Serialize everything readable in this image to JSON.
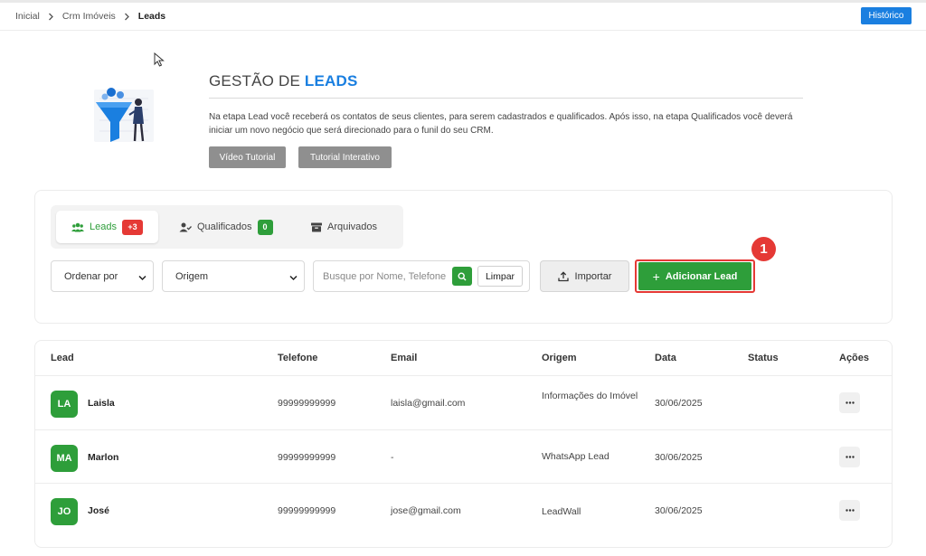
{
  "breadcrumb": [
    "Inicial",
    "Crm Imóveis",
    "Leads"
  ],
  "header": {
    "historico_label": "Histórico"
  },
  "hero": {
    "title_prefix": "GESTÃO DE ",
    "title_accent": "LEADS",
    "description": "Na etapa Lead você receberá os contatos de seus clientes, para serem cadastrados e qualificados. Após isso, na etapa Qualificados você deverá iniciar um novo negócio que será direcionado para o funil do seu CRM.",
    "video_label": "Vídeo Tutorial",
    "interativo_label": "Tutorial Interativo"
  },
  "tabs": [
    {
      "label": "Leads",
      "badge": "+3",
      "icon": "users-icon"
    },
    {
      "label": "Qualificados",
      "badge": "0",
      "icon": "user-check-icon"
    },
    {
      "label": "Arquivados",
      "badge": "",
      "icon": "archive-icon"
    }
  ],
  "filters": {
    "ordenar": "Ordenar por",
    "origem": "Origem",
    "search_placeholder": "Busque por Nome, Telefone",
    "limpar_label": "Limpar",
    "importar_label": "Importar",
    "add_lead_label": "Adicionar Lead",
    "step_marker": "1"
  },
  "table": {
    "headers": [
      "Lead",
      "Telefone",
      "Email",
      "Origem",
      "Data",
      "Status",
      "Ações"
    ],
    "rows": [
      {
        "initials": "LA",
        "name": "Laisla",
        "telefone": "99999999999",
        "email": "laisla@gmail.com",
        "origem": "Informações do Imóvel",
        "data": "30/06/2025",
        "status": ""
      },
      {
        "initials": "MA",
        "name": "Marlon",
        "telefone": "99999999999",
        "email": "-",
        "origem": "WhatsApp Lead",
        "data": "30/06/2025",
        "status": ""
      },
      {
        "initials": "JO",
        "name": "José",
        "telefone": "99999999999",
        "email": "jose@gmail.com",
        "origem": "LeadWall",
        "data": "30/06/2025",
        "status": ""
      }
    ]
  },
  "colors": {
    "accent_blue": "#1a7fe0",
    "green": "#2e9e3a",
    "red": "#e53935",
    "gray_button": "#8f8f8f"
  }
}
